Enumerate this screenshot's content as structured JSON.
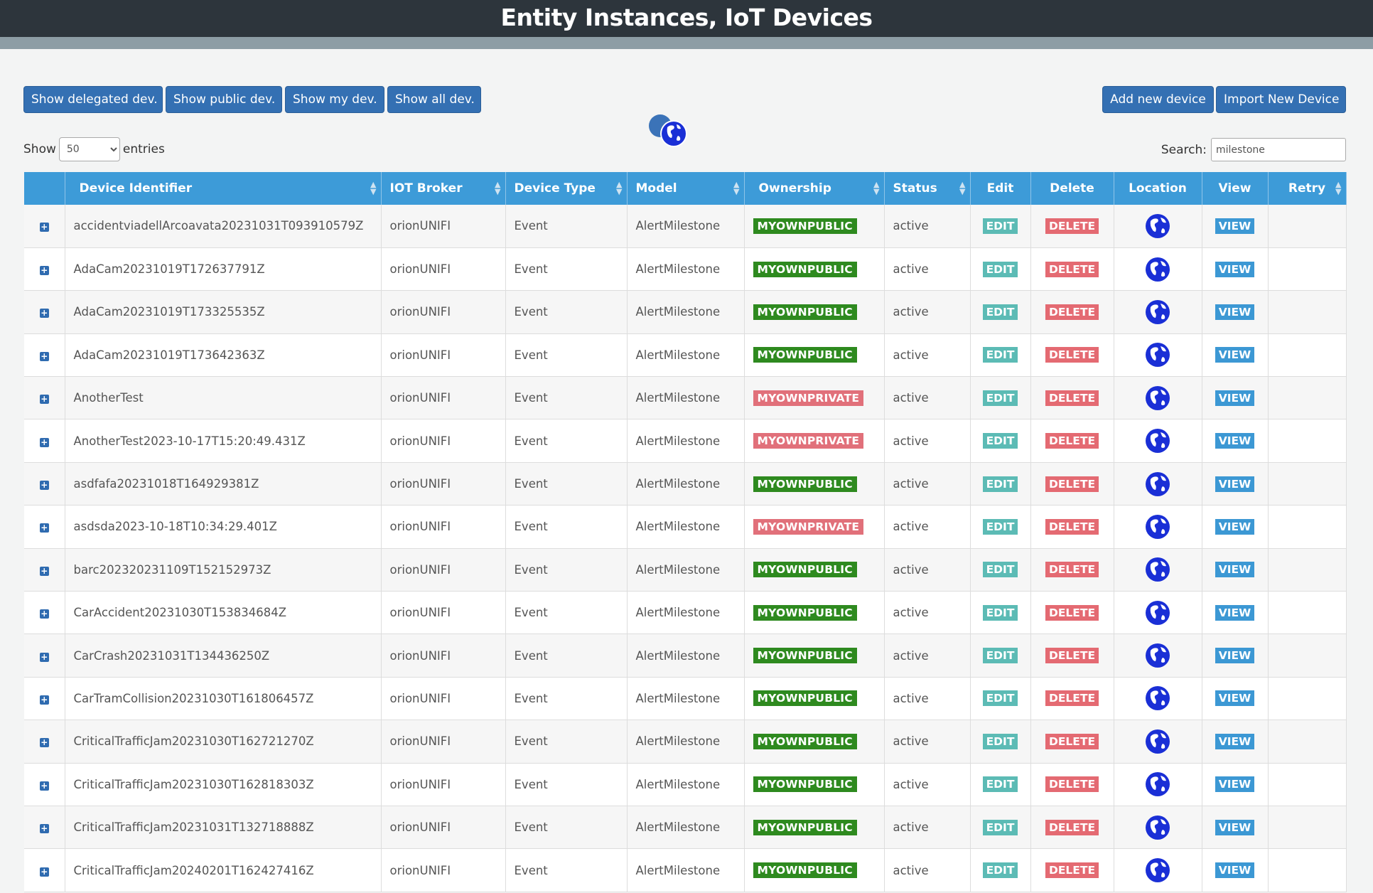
{
  "header": {
    "title": "Entity Instances, IoT Devices"
  },
  "toolbar": {
    "left_buttons": [
      "Show delegated dev.",
      "Show public dev.",
      "Show my dev.",
      "Show all dev."
    ],
    "right_buttons": [
      "Add new device",
      "Import New Device"
    ]
  },
  "length": {
    "prefix": "Show",
    "value": "50",
    "suffix": "entries"
  },
  "search": {
    "label": "Search:",
    "value": "milestone"
  },
  "columns": [
    "Device Identifier",
    "IOT Broker",
    "Device Type",
    "Model",
    "Ownership",
    "Status",
    "Edit",
    "Delete",
    "Location",
    "View",
    "Retry"
  ],
  "colors": {
    "public": "#2e8a1f",
    "private": "#e1707a",
    "header": "#3d9bd8",
    "topbar": "#2d353c"
  },
  "rows": [
    {
      "id": "accidentviadellArcoavata20231031T093910579Z",
      "broker": "orionUNIFI",
      "type": "Event",
      "model": "AlertMilestone",
      "ownership": "MYOWNPUBLIC",
      "status": "active",
      "edit": "EDIT",
      "delete": "DELETE",
      "view": "VIEW"
    },
    {
      "id": "AdaCam20231019T172637791Z",
      "broker": "orionUNIFI",
      "type": "Event",
      "model": "AlertMilestone",
      "ownership": "MYOWNPUBLIC",
      "status": "active",
      "edit": "EDIT",
      "delete": "DELETE",
      "view": "VIEW"
    },
    {
      "id": "AdaCam20231019T173325535Z",
      "broker": "orionUNIFI",
      "type": "Event",
      "model": "AlertMilestone",
      "ownership": "MYOWNPUBLIC",
      "status": "active",
      "edit": "EDIT",
      "delete": "DELETE",
      "view": "VIEW"
    },
    {
      "id": "AdaCam20231019T173642363Z",
      "broker": "orionUNIFI",
      "type": "Event",
      "model": "AlertMilestone",
      "ownership": "MYOWNPUBLIC",
      "status": "active",
      "edit": "EDIT",
      "delete": "DELETE",
      "view": "VIEW"
    },
    {
      "id": "AnotherTest",
      "broker": "orionUNIFI",
      "type": "Event",
      "model": "AlertMilestone",
      "ownership": "MYOWNPRIVATE",
      "status": "active",
      "edit": "EDIT",
      "delete": "DELETE",
      "view": "VIEW"
    },
    {
      "id": "AnotherTest2023-10-17T15:20:49.431Z",
      "broker": "orionUNIFI",
      "type": "Event",
      "model": "AlertMilestone",
      "ownership": "MYOWNPRIVATE",
      "status": "active",
      "edit": "EDIT",
      "delete": "DELETE",
      "view": "VIEW"
    },
    {
      "id": "asdfafa20231018T164929381Z",
      "broker": "orionUNIFI",
      "type": "Event",
      "model": "AlertMilestone",
      "ownership": "MYOWNPUBLIC",
      "status": "active",
      "edit": "EDIT",
      "delete": "DELETE",
      "view": "VIEW"
    },
    {
      "id": "asdsda2023-10-18T10:34:29.401Z",
      "broker": "orionUNIFI",
      "type": "Event",
      "model": "AlertMilestone",
      "ownership": "MYOWNPRIVATE",
      "status": "active",
      "edit": "EDIT",
      "delete": "DELETE",
      "view": "VIEW"
    },
    {
      "id": "barc202320231109T152152973Z",
      "broker": "orionUNIFI",
      "type": "Event",
      "model": "AlertMilestone",
      "ownership": "MYOWNPUBLIC",
      "status": "active",
      "edit": "EDIT",
      "delete": "DELETE",
      "view": "VIEW"
    },
    {
      "id": "CarAccident20231030T153834684Z",
      "broker": "orionUNIFI",
      "type": "Event",
      "model": "AlertMilestone",
      "ownership": "MYOWNPUBLIC",
      "status": "active",
      "edit": "EDIT",
      "delete": "DELETE",
      "view": "VIEW"
    },
    {
      "id": "CarCrash20231031T134436250Z",
      "broker": "orionUNIFI",
      "type": "Event",
      "model": "AlertMilestone",
      "ownership": "MYOWNPUBLIC",
      "status": "active",
      "edit": "EDIT",
      "delete": "DELETE",
      "view": "VIEW"
    },
    {
      "id": "CarTramCollision20231030T161806457Z",
      "broker": "orionUNIFI",
      "type": "Event",
      "model": "AlertMilestone",
      "ownership": "MYOWNPUBLIC",
      "status": "active",
      "edit": "EDIT",
      "delete": "DELETE",
      "view": "VIEW"
    },
    {
      "id": "CriticalTrafficJam20231030T162721270Z",
      "broker": "orionUNIFI",
      "type": "Event",
      "model": "AlertMilestone",
      "ownership": "MYOWNPUBLIC",
      "status": "active",
      "edit": "EDIT",
      "delete": "DELETE",
      "view": "VIEW"
    },
    {
      "id": "CriticalTrafficJam20231030T162818303Z",
      "broker": "orionUNIFI",
      "type": "Event",
      "model": "AlertMilestone",
      "ownership": "MYOWNPUBLIC",
      "status": "active",
      "edit": "EDIT",
      "delete": "DELETE",
      "view": "VIEW"
    },
    {
      "id": "CriticalTrafficJam20231031T132718888Z",
      "broker": "orionUNIFI",
      "type": "Event",
      "model": "AlertMilestone",
      "ownership": "MYOWNPUBLIC",
      "status": "active",
      "edit": "EDIT",
      "delete": "DELETE",
      "view": "VIEW"
    },
    {
      "id": "CriticalTrafficJam20240201T162427416Z",
      "broker": "orionUNIFI",
      "type": "Event",
      "model": "AlertMilestone",
      "ownership": "MYOWNPUBLIC",
      "status": "active",
      "edit": "EDIT",
      "delete": "DELETE",
      "view": "VIEW"
    }
  ]
}
